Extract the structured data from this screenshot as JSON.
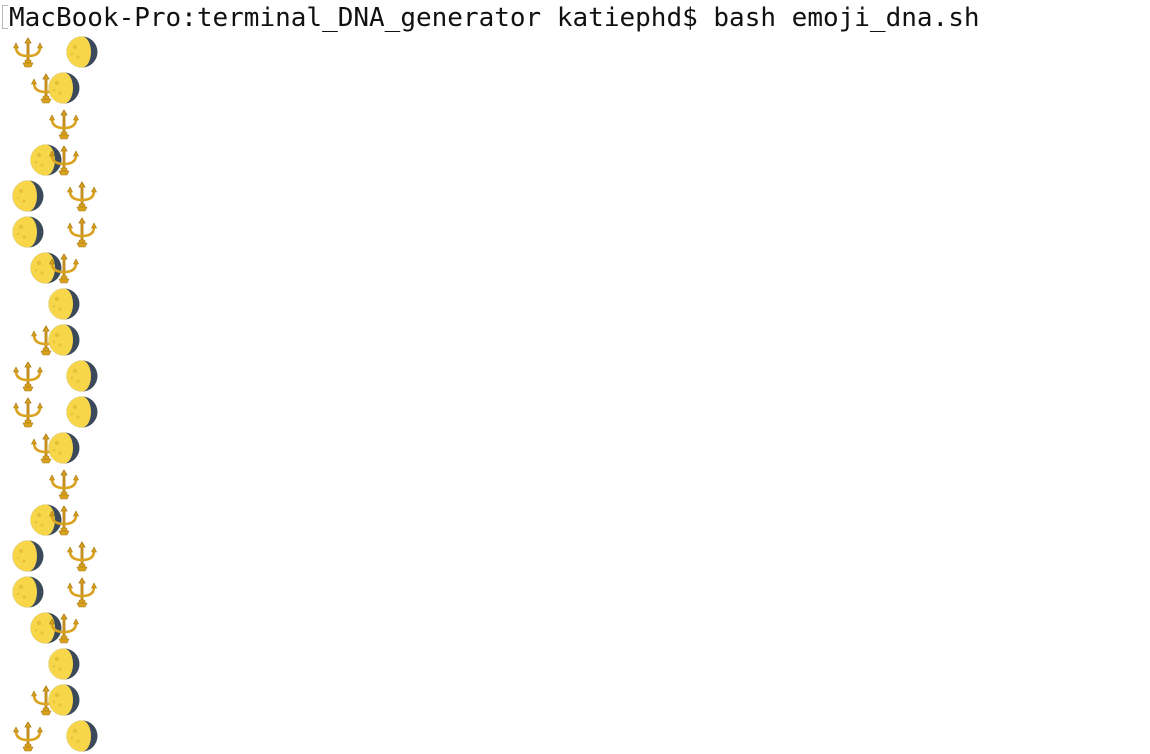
{
  "terminal": {
    "prompt": "MacBook-Pro:terminal_DNA_generator katiephd$ bash emoji_dna.sh",
    "cursor_glyph": "["
  },
  "glyph_names": {
    "T": "trident-icon",
    "M": "moon-icon"
  },
  "colors": {
    "background": "#ffffff",
    "text": "#111111",
    "trident_gold": "#d9a21f",
    "moon_yellow": "#f7d64a",
    "moon_shadow": "#3a4a5a"
  },
  "output_rows": [
    [
      [
        "T",
        0
      ],
      [
        "M",
        3
      ]
    ],
    [
      [
        "T",
        1
      ],
      [
        "M",
        2
      ]
    ],
    [
      [
        "T",
        2
      ]
    ],
    [
      [
        "M",
        1
      ],
      [
        "T",
        2
      ]
    ],
    [
      [
        "M",
        0
      ],
      [
        "T",
        3
      ]
    ],
    [
      [
        "M",
        0
      ],
      [
        "T",
        3
      ]
    ],
    [
      [
        "M",
        1
      ],
      [
        "T",
        2
      ]
    ],
    [
      [
        "M",
        2
      ]
    ],
    [
      [
        "T",
        1
      ],
      [
        "M",
        2
      ]
    ],
    [
      [
        "T",
        0
      ],
      [
        "M",
        3
      ]
    ],
    [
      [
        "T",
        0
      ],
      [
        "M",
        3
      ]
    ],
    [
      [
        "T",
        1
      ],
      [
        "M",
        2
      ]
    ],
    [
      [
        "T",
        2
      ]
    ],
    [
      [
        "M",
        1
      ],
      [
        "T",
        2
      ]
    ],
    [
      [
        "M",
        0
      ],
      [
        "T",
        3
      ]
    ],
    [
      [
        "M",
        0
      ],
      [
        "T",
        3
      ]
    ],
    [
      [
        "M",
        1
      ],
      [
        "T",
        2
      ]
    ],
    [
      [
        "M",
        2
      ]
    ],
    [
      [
        "T",
        1
      ],
      [
        "M",
        2
      ]
    ],
    [
      [
        "T",
        0
      ],
      [
        "M",
        3
      ]
    ]
  ]
}
